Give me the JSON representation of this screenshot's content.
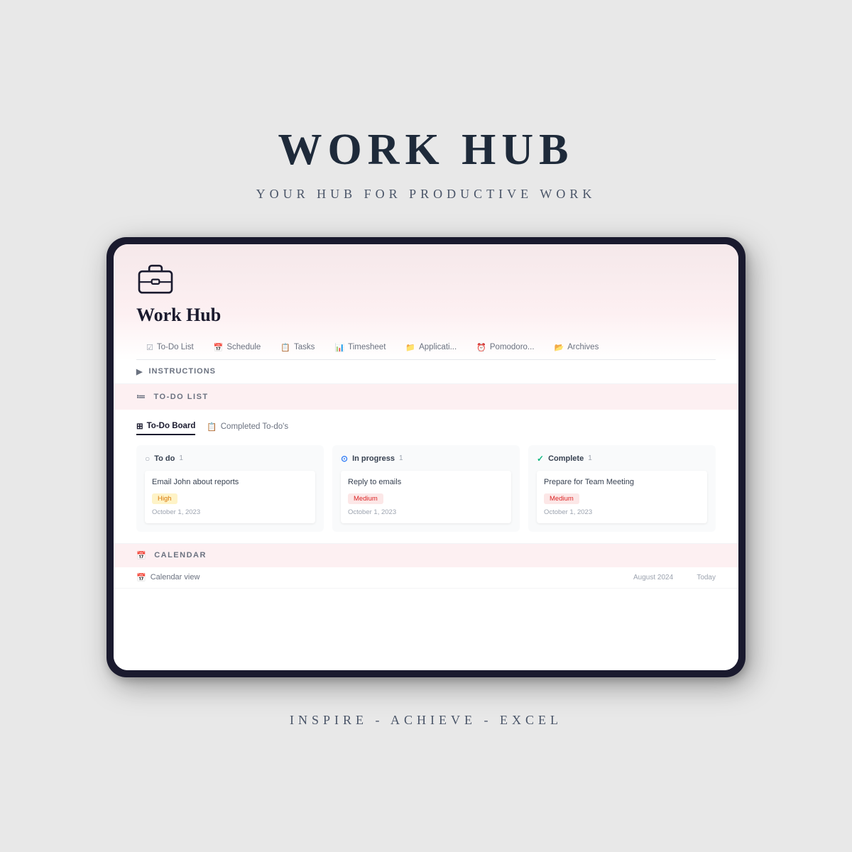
{
  "header": {
    "title": "WORK HUB",
    "subtitle": "YOUR HUB FOR PRODUCTIVE WORK",
    "tagline": "INSPIRE - ACHIEVE - EXCEL"
  },
  "notion": {
    "page_name": "Work Hub",
    "nav_tabs": [
      {
        "label": "To-Do List",
        "icon": "☑"
      },
      {
        "label": "Schedule",
        "icon": "📅"
      },
      {
        "label": "Tasks",
        "icon": "📋"
      },
      {
        "label": "Timesheet",
        "icon": "📊"
      },
      {
        "label": "Applicati...",
        "icon": "📁"
      },
      {
        "label": "Pomodoro...",
        "icon": "⏰"
      },
      {
        "label": "Archives",
        "icon": "📂"
      }
    ],
    "instructions_label": "INSTRUCTIONS",
    "todo_section_label": "TO-DO LIST",
    "kanban": {
      "tabs": [
        {
          "label": "To-Do Board",
          "icon": "⊞",
          "active": true
        },
        {
          "label": "Completed To-do's",
          "icon": "📋",
          "active": false
        }
      ],
      "columns": [
        {
          "id": "todo",
          "label": "To do",
          "count": "1",
          "icon_type": "circle",
          "cards": [
            {
              "title": "Email John about reports",
              "badge": "High",
              "badge_type": "high",
              "date": "October 1, 2023"
            }
          ]
        },
        {
          "id": "inprogress",
          "label": "In progress",
          "count": "1",
          "icon_type": "progress",
          "cards": [
            {
              "title": "Reply to emails",
              "badge": "Medium",
              "badge_type": "medium",
              "date": "October 1, 2023"
            }
          ]
        },
        {
          "id": "complete",
          "label": "Complete",
          "count": "1",
          "icon_type": "check",
          "cards": [
            {
              "title": "Prepare for Team Meeting",
              "badge": "Medium",
              "badge_type": "medium",
              "date": "October 1, 2023"
            }
          ]
        }
      ]
    },
    "calendar_section_label": "CALENDAR",
    "calendar_view_label": "Calendar view",
    "calendar_month_hint": "August 2024",
    "calendar_today_label": "Today"
  }
}
